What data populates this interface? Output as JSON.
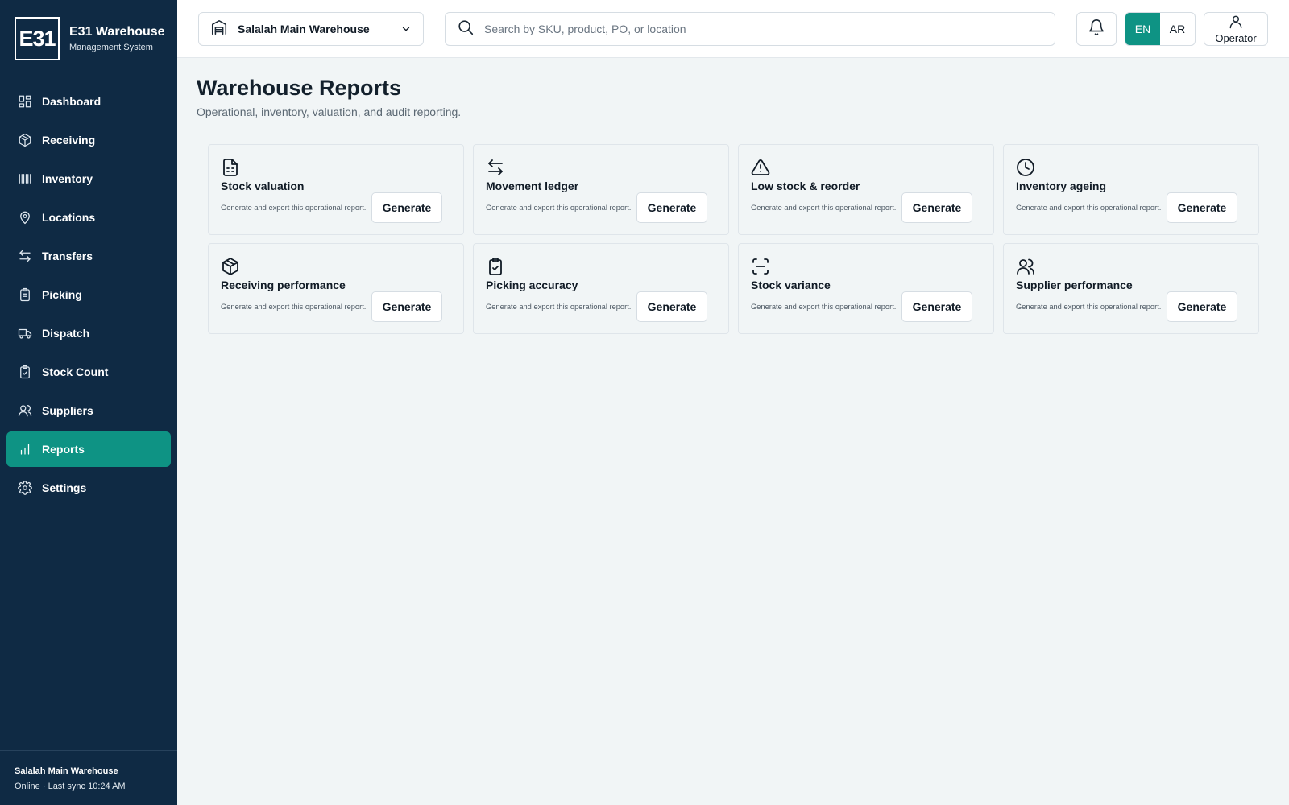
{
  "brand": {
    "logo": "E31",
    "title": "E31 Warehouse",
    "subtitle": "Management System"
  },
  "sidebar": {
    "items": [
      {
        "label": "Dashboard",
        "icon": "dashboard-icon",
        "active": false
      },
      {
        "label": "Receiving",
        "icon": "box-icon",
        "active": false
      },
      {
        "label": "Inventory",
        "icon": "barcode-icon",
        "active": false
      },
      {
        "label": "Locations",
        "icon": "map-pin-icon",
        "active": false
      },
      {
        "label": "Transfers",
        "icon": "arrows-left-right-icon",
        "active": false
      },
      {
        "label": "Picking",
        "icon": "clipboard-list-icon",
        "active": false
      },
      {
        "label": "Dispatch",
        "icon": "truck-icon",
        "active": false
      },
      {
        "label": "Stock Count",
        "icon": "clipboard-check-icon",
        "active": false
      },
      {
        "label": "Suppliers",
        "icon": "users-icon",
        "active": false
      },
      {
        "label": "Reports",
        "icon": "bar-chart-icon",
        "active": true
      },
      {
        "label": "Settings",
        "icon": "gear-icon",
        "active": false
      }
    ],
    "footer": {
      "warehouse": "Salalah Main Warehouse",
      "status": "Online · Last sync 10:24 AM"
    }
  },
  "topbar": {
    "warehouse_select": "Salalah Main Warehouse",
    "search_placeholder": "Search by SKU, product, PO, or location",
    "lang_en": "EN",
    "lang_ar": "AR",
    "active_lang": "EN",
    "user_label": "Operator"
  },
  "main": {
    "title": "Warehouse Reports",
    "subtitle": "Operational, inventory, valuation, and audit reporting.",
    "reports": [
      {
        "title": "Stock valuation",
        "icon": "file-text-icon",
        "description": "Generate and export this operational report.",
        "button": "Generate"
      },
      {
        "title": "Movement ledger",
        "icon": "arrows-left-right-icon",
        "description": "Generate and export this operational report.",
        "button": "Generate"
      },
      {
        "title": "Low stock & reorder",
        "icon": "warning-triangle-icon",
        "description": "Generate and export this operational report.",
        "button": "Generate"
      },
      {
        "title": "Inventory ageing",
        "icon": "clock-icon",
        "description": "Generate and export this operational report.",
        "button": "Generate"
      },
      {
        "title": "Receiving performance",
        "icon": "box-icon",
        "description": "Generate and export this operational report.",
        "button": "Generate"
      },
      {
        "title": "Picking accuracy",
        "icon": "clipboard-check-icon",
        "description": "Generate and export this operational report.",
        "button": "Generate"
      },
      {
        "title": "Stock variance",
        "icon": "scan-icon",
        "description": "Generate and export this operational report.",
        "button": "Generate"
      },
      {
        "title": "Supplier performance",
        "icon": "users-icon",
        "description": "Generate and export this operational report.",
        "button": "Generate"
      }
    ]
  },
  "colors": {
    "sidebar_bg": "#0f2a44",
    "accent": "#0e9384",
    "page_bg": "#f1f5f6"
  }
}
